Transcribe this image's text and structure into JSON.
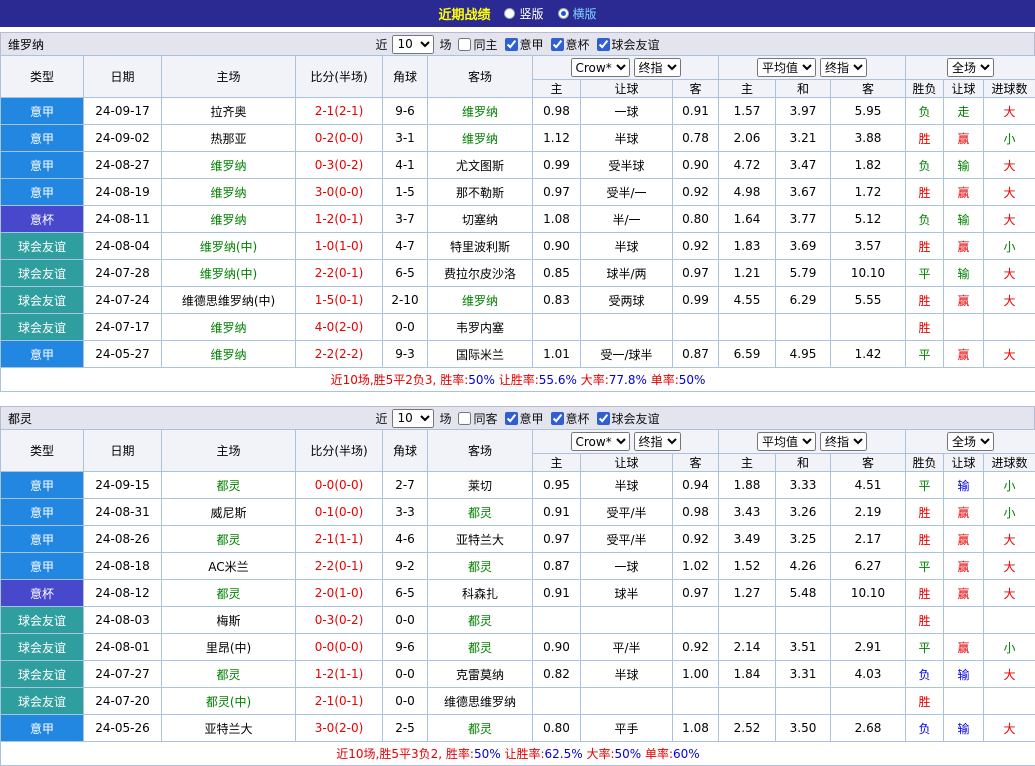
{
  "topbar": {
    "title": "近期战绩",
    "options": [
      {
        "label": "竖版",
        "selected": false
      },
      {
        "label": "横版",
        "selected": true
      }
    ]
  },
  "controls": {
    "near": "近",
    "count": "10",
    "unit": "场"
  },
  "table_header": {
    "left": [
      "类型",
      "日期",
      "主场",
      "比分(半场)",
      "角球",
      "客场"
    ],
    "odds_selects": [
      "Crow*",
      "终指"
    ],
    "avg_selects": [
      "平均值",
      "终指"
    ],
    "full_selects": [
      "全场"
    ],
    "sub": [
      "主",
      "让球",
      "客",
      "主",
      "和",
      "客",
      "胜负",
      "让球",
      "进球数"
    ]
  },
  "colors": {
    "league": {
      "意甲": "#2287e0",
      "意杯": "#4848cc",
      "球会友谊": "#2f9e9e"
    },
    "win": "#e60000",
    "draw": "#008000",
    "lose": "#0000e0",
    "score": "#e60000",
    "focus_team": "#008000",
    "topbar_bg": "#2a2a92",
    "title": "#ffff00"
  },
  "sections": [
    {
      "team": "维罗纳",
      "same_filter": "同主",
      "same_checked": false,
      "filters": [
        {
          "label": "意甲",
          "checked": true
        },
        {
          "label": "意杯",
          "checked": true
        },
        {
          "label": "球会友谊",
          "checked": true
        }
      ],
      "rows": [
        {
          "league": "意甲",
          "date": "24-09-17",
          "home": "拉齐奥",
          "home_focus": false,
          "score": "2-1(2-1)",
          "corners": "9-6",
          "away": "维罗纳",
          "away_focus": true,
          "odds": [
            "0.98",
            "一球",
            "0.91",
            "1.57",
            "3.97",
            "5.95"
          ],
          "results": [
            {
              "t": "负",
              "c": "g"
            },
            {
              "t": "走",
              "c": "g"
            },
            {
              "t": "大",
              "c": "r"
            }
          ]
        },
        {
          "league": "意甲",
          "date": "24-09-02",
          "home": "热那亚",
          "home_focus": false,
          "score": "0-2(0-0)",
          "corners": "3-1",
          "away": "维罗纳",
          "away_focus": true,
          "odds": [
            "1.12",
            "半球",
            "0.78",
            "2.06",
            "3.21",
            "3.88"
          ],
          "results": [
            {
              "t": "胜",
              "c": "r"
            },
            {
              "t": "赢",
              "c": "r"
            },
            {
              "t": "小",
              "c": "g"
            }
          ]
        },
        {
          "league": "意甲",
          "date": "24-08-27",
          "home": "维罗纳",
          "home_focus": true,
          "score": "0-3(0-2)",
          "corners": "4-1",
          "away": "尤文图斯",
          "away_focus": false,
          "odds": [
            "0.99",
            "受半球",
            "0.90",
            "4.72",
            "3.47",
            "1.82"
          ],
          "results": [
            {
              "t": "负",
              "c": "g"
            },
            {
              "t": "输",
              "c": "g"
            },
            {
              "t": "大",
              "c": "r"
            }
          ]
        },
        {
          "league": "意甲",
          "date": "24-08-19",
          "home": "维罗纳",
          "home_focus": true,
          "score": "3-0(0-0)",
          "corners": "1-5",
          "away": "那不勒斯",
          "away_focus": false,
          "odds": [
            "0.97",
            "受半/一",
            "0.92",
            "4.98",
            "3.67",
            "1.72"
          ],
          "results": [
            {
              "t": "胜",
              "c": "r"
            },
            {
              "t": "赢",
              "c": "r"
            },
            {
              "t": "大",
              "c": "r"
            }
          ]
        },
        {
          "league": "意杯",
          "date": "24-08-11",
          "home": "维罗纳",
          "home_focus": true,
          "score": "1-2(0-1)",
          "corners": "3-7",
          "away": "切塞纳",
          "away_focus": false,
          "odds": [
            "1.08",
            "半/一",
            "0.80",
            "1.64",
            "3.77",
            "5.12"
          ],
          "results": [
            {
              "t": "负",
              "c": "g"
            },
            {
              "t": "输",
              "c": "g"
            },
            {
              "t": "大",
              "c": "r"
            }
          ]
        },
        {
          "league": "球会友谊",
          "date": "24-08-04",
          "home": "维罗纳(中)",
          "home_focus": true,
          "score": "1-0(1-0)",
          "corners": "4-7",
          "away": "特里波利斯",
          "away_focus": false,
          "odds": [
            "0.90",
            "半球",
            "0.92",
            "1.83",
            "3.69",
            "3.57"
          ],
          "results": [
            {
              "t": "胜",
              "c": "r"
            },
            {
              "t": "赢",
              "c": "r"
            },
            {
              "t": "小",
              "c": "g"
            }
          ]
        },
        {
          "league": "球会友谊",
          "date": "24-07-28",
          "home": "维罗纳(中)",
          "home_focus": true,
          "score": "2-2(0-1)",
          "corners": "6-5",
          "away": "费拉尔皮沙洛",
          "away_focus": false,
          "odds": [
            "0.85",
            "球半/两",
            "0.97",
            "1.21",
            "5.79",
            "10.10"
          ],
          "results": [
            {
              "t": "平",
              "c": "g"
            },
            {
              "t": "输",
              "c": "g"
            },
            {
              "t": "大",
              "c": "r"
            }
          ]
        },
        {
          "league": "球会友谊",
          "date": "24-07-24",
          "home": "维德思维罗纳(中)",
          "home_focus": false,
          "score": "1-5(0-1)",
          "corners": "2-10",
          "away": "维罗纳",
          "away_focus": true,
          "odds": [
            "0.83",
            "受两球",
            "0.99",
            "4.55",
            "6.29",
            "5.55"
          ],
          "results": [
            {
              "t": "胜",
              "c": "r"
            },
            {
              "t": "赢",
              "c": "r"
            },
            {
              "t": "大",
              "c": "r"
            }
          ]
        },
        {
          "league": "球会友谊",
          "date": "24-07-17",
          "home": "维罗纳",
          "home_focus": true,
          "score": "4-0(2-0)",
          "corners": "0-0",
          "away": "韦罗内塞",
          "away_focus": false,
          "odds": [
            "",
            "",
            "",
            "",
            "",
            ""
          ],
          "results": [
            {
              "t": "胜",
              "c": "r"
            },
            {
              "t": "",
              "c": ""
            },
            {
              "t": "",
              "c": ""
            }
          ]
        },
        {
          "league": "意甲",
          "date": "24-05-27",
          "home": "维罗纳",
          "home_focus": true,
          "score": "2-2(2-2)",
          "corners": "9-3",
          "away": "国际米兰",
          "away_focus": false,
          "odds": [
            "1.01",
            "受一/球半",
            "0.87",
            "6.59",
            "4.95",
            "1.42"
          ],
          "results": [
            {
              "t": "平",
              "c": "g"
            },
            {
              "t": "赢",
              "c": "r"
            },
            {
              "t": "大",
              "c": "r"
            }
          ]
        }
      ],
      "summary": {
        "prefix": "近10场,胜5平2负3,",
        "stats": [
          {
            "label": "胜率:",
            "value": "50%"
          },
          {
            "label": "让胜率:",
            "value": "55.6%"
          },
          {
            "label": "大率:",
            "value": "77.8%"
          },
          {
            "label": "单率:",
            "value": "50%"
          }
        ]
      }
    },
    {
      "team": "都灵",
      "same_filter": "同客",
      "same_checked": false,
      "filters": [
        {
          "label": "意甲",
          "checked": true
        },
        {
          "label": "意杯",
          "checked": true
        },
        {
          "label": "球会友谊",
          "checked": true
        }
      ],
      "rows": [
        {
          "league": "意甲",
          "date": "24-09-15",
          "home": "都灵",
          "home_focus": true,
          "score": "0-0(0-0)",
          "corners": "2-7",
          "away": "莱切",
          "away_focus": false,
          "odds": [
            "0.95",
            "半球",
            "0.94",
            "1.88",
            "3.33",
            "4.51"
          ],
          "results": [
            {
              "t": "平",
              "c": "g"
            },
            {
              "t": "输",
              "c": "b"
            },
            {
              "t": "小",
              "c": "g"
            }
          ]
        },
        {
          "league": "意甲",
          "date": "24-08-31",
          "home": "威尼斯",
          "home_focus": false,
          "score": "0-1(0-0)",
          "corners": "3-3",
          "away": "都灵",
          "away_focus": true,
          "odds": [
            "0.91",
            "受平/半",
            "0.98",
            "3.43",
            "3.26",
            "2.19"
          ],
          "results": [
            {
              "t": "胜",
              "c": "r"
            },
            {
              "t": "赢",
              "c": "r"
            },
            {
              "t": "小",
              "c": "g"
            }
          ]
        },
        {
          "league": "意甲",
          "date": "24-08-26",
          "home": "都灵",
          "home_focus": true,
          "score": "2-1(1-1)",
          "corners": "4-6",
          "away": "亚特兰大",
          "away_focus": false,
          "odds": [
            "0.97",
            "受平/半",
            "0.92",
            "3.49",
            "3.25",
            "2.17"
          ],
          "results": [
            {
              "t": "胜",
              "c": "r"
            },
            {
              "t": "赢",
              "c": "r"
            },
            {
              "t": "大",
              "c": "r"
            }
          ]
        },
        {
          "league": "意甲",
          "date": "24-08-18",
          "home": "AC米兰",
          "home_focus": false,
          "score": "2-2(0-1)",
          "corners": "9-2",
          "away": "都灵",
          "away_focus": true,
          "odds": [
            "0.87",
            "一球",
            "1.02",
            "1.52",
            "4.26",
            "6.27"
          ],
          "results": [
            {
              "t": "平",
              "c": "g"
            },
            {
              "t": "赢",
              "c": "r"
            },
            {
              "t": "大",
              "c": "r"
            }
          ]
        },
        {
          "league": "意杯",
          "date": "24-08-12",
          "home": "都灵",
          "home_focus": true,
          "score": "2-0(1-0)",
          "corners": "6-5",
          "away": "科森扎",
          "away_focus": false,
          "odds": [
            "0.91",
            "球半",
            "0.97",
            "1.27",
            "5.48",
            "10.10"
          ],
          "results": [
            {
              "t": "胜",
              "c": "r"
            },
            {
              "t": "赢",
              "c": "r"
            },
            {
              "t": "大",
              "c": "r"
            }
          ]
        },
        {
          "league": "球会友谊",
          "date": "24-08-03",
          "home": "梅斯",
          "home_focus": false,
          "score": "0-3(0-2)",
          "corners": "0-0",
          "away": "都灵",
          "away_focus": true,
          "odds": [
            "",
            "",
            "",
            "",
            "",
            ""
          ],
          "results": [
            {
              "t": "胜",
              "c": "r"
            },
            {
              "t": "",
              "c": ""
            },
            {
              "t": "",
              "c": ""
            }
          ]
        },
        {
          "league": "球会友谊",
          "date": "24-08-01",
          "home": "里昂(中)",
          "home_focus": false,
          "score": "0-0(0-0)",
          "corners": "9-6",
          "away": "都灵",
          "away_focus": true,
          "odds": [
            "0.90",
            "平/半",
            "0.92",
            "2.14",
            "3.51",
            "2.91"
          ],
          "results": [
            {
              "t": "平",
              "c": "g"
            },
            {
              "t": "赢",
              "c": "r"
            },
            {
              "t": "小",
              "c": "g"
            }
          ]
        },
        {
          "league": "球会友谊",
          "date": "24-07-27",
          "home": "都灵",
          "home_focus": true,
          "score": "1-2(1-1)",
          "corners": "0-0",
          "away": "克雷莫纳",
          "away_focus": false,
          "odds": [
            "0.82",
            "半球",
            "1.00",
            "1.84",
            "3.31",
            "4.03"
          ],
          "results": [
            {
              "t": "负",
              "c": "b"
            },
            {
              "t": "输",
              "c": "b"
            },
            {
              "t": "大",
              "c": "r"
            }
          ]
        },
        {
          "league": "球会友谊",
          "date": "24-07-20",
          "home": "都灵(中)",
          "home_focus": true,
          "score": "2-1(0-1)",
          "corners": "0-0",
          "away": "维德思维罗纳",
          "away_focus": false,
          "odds": [
            "",
            "",
            "",
            "",
            "",
            ""
          ],
          "results": [
            {
              "t": "胜",
              "c": "r"
            },
            {
              "t": "",
              "c": ""
            },
            {
              "t": "",
              "c": ""
            }
          ]
        },
        {
          "league": "意甲",
          "date": "24-05-26",
          "home": "亚特兰大",
          "home_focus": false,
          "score": "3-0(2-0)",
          "corners": "2-5",
          "away": "都灵",
          "away_focus": true,
          "odds": [
            "0.80",
            "平手",
            "1.08",
            "2.52",
            "3.50",
            "2.68"
          ],
          "results": [
            {
              "t": "负",
              "c": "b"
            },
            {
              "t": "输",
              "c": "b"
            },
            {
              "t": "大",
              "c": "r"
            }
          ]
        }
      ],
      "summary": {
        "prefix": "近10场,胜5平3负2,",
        "stats": [
          {
            "label": "胜率:",
            "value": "50%"
          },
          {
            "label": "让胜率:",
            "value": "62.5%"
          },
          {
            "label": "大率:",
            "value": "50%"
          },
          {
            "label": "单率:",
            "value": "60%"
          }
        ]
      }
    }
  ]
}
